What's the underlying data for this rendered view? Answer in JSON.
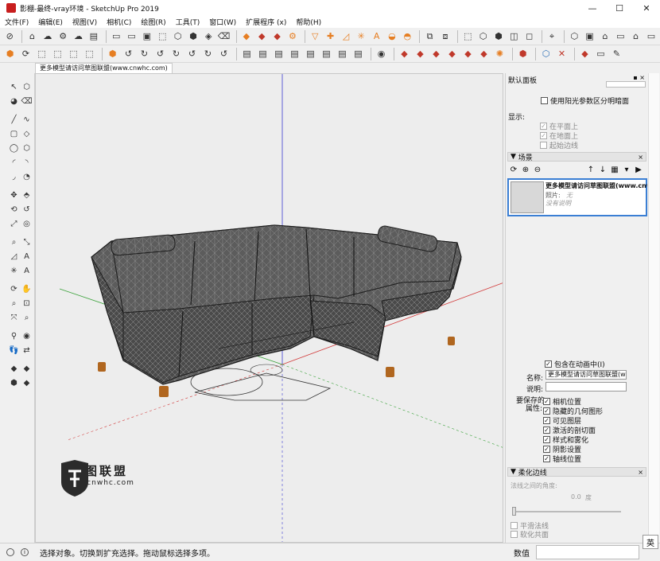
{
  "window": {
    "title": "影棚-最终-vray环境 - SketchUp Pro 2019",
    "minimize": "—",
    "maximize": "☐",
    "close": "✕"
  },
  "menu": [
    "文件(F)",
    "编辑(E)",
    "视图(V)",
    "相机(C)",
    "绘图(R)",
    "工具(T)",
    "窗口(W)",
    "扩展程序 (x)",
    "帮助(H)"
  ],
  "document_tab": "更多模型请访问草图联盟(www.cnwhc.com)",
  "watermark": {
    "title": "草图联盟",
    "url": "www.cnwhc.com"
  },
  "status": {
    "info_icon": "i",
    "message": "选择对象。切换到扩充选择。拖动鼠标选择多项。",
    "measure_label": "数值",
    "ime": "英"
  },
  "panel": {
    "title": "默认面板",
    "pin": "▪ ×",
    "shadow": {
      "use_sun_label": "使用阳光参数区分明暗面",
      "display_label": "显示:",
      "on_faces": "在平面上",
      "on_ground": "在地面上",
      "from_edges": "起始边线"
    },
    "scenes": {
      "header": "场景",
      "close": "×",
      "item": {
        "name": "更多模型请访问草图联盟(www.cnwhc.com)",
        "photo_label": "照片:",
        "photo_value": "无",
        "desc": "没有说明"
      },
      "include_animation": "包含在动画中(I)",
      "name_label": "名称:",
      "name_value": "更多模型请访问草图联盟(ww",
      "desc_label": "说明:",
      "desc_value": "",
      "props_label_1": "要保存的",
      "props_label_2": "属性:",
      "props": [
        "相机位置",
        "隐藏的几何图形",
        "可见图层",
        "激活的剖切面",
        "样式和雾化",
        "阴影设置",
        "轴线位置"
      ]
    },
    "soften": {
      "header": "柔化边线",
      "close": "×",
      "angle_label": "法线之间的角度:",
      "angle_value": "0.0",
      "angle_unit": "度",
      "smooth_normals": "平滑法线",
      "soften_coplanar": "软化共面"
    }
  },
  "colors": {
    "axis_red": "#d23c3c",
    "axis_green": "#3aa23a",
    "axis_blue": "#3a3ad2",
    "sofa_fill": "#5c5c5c",
    "selection": "#3b7fd4"
  }
}
